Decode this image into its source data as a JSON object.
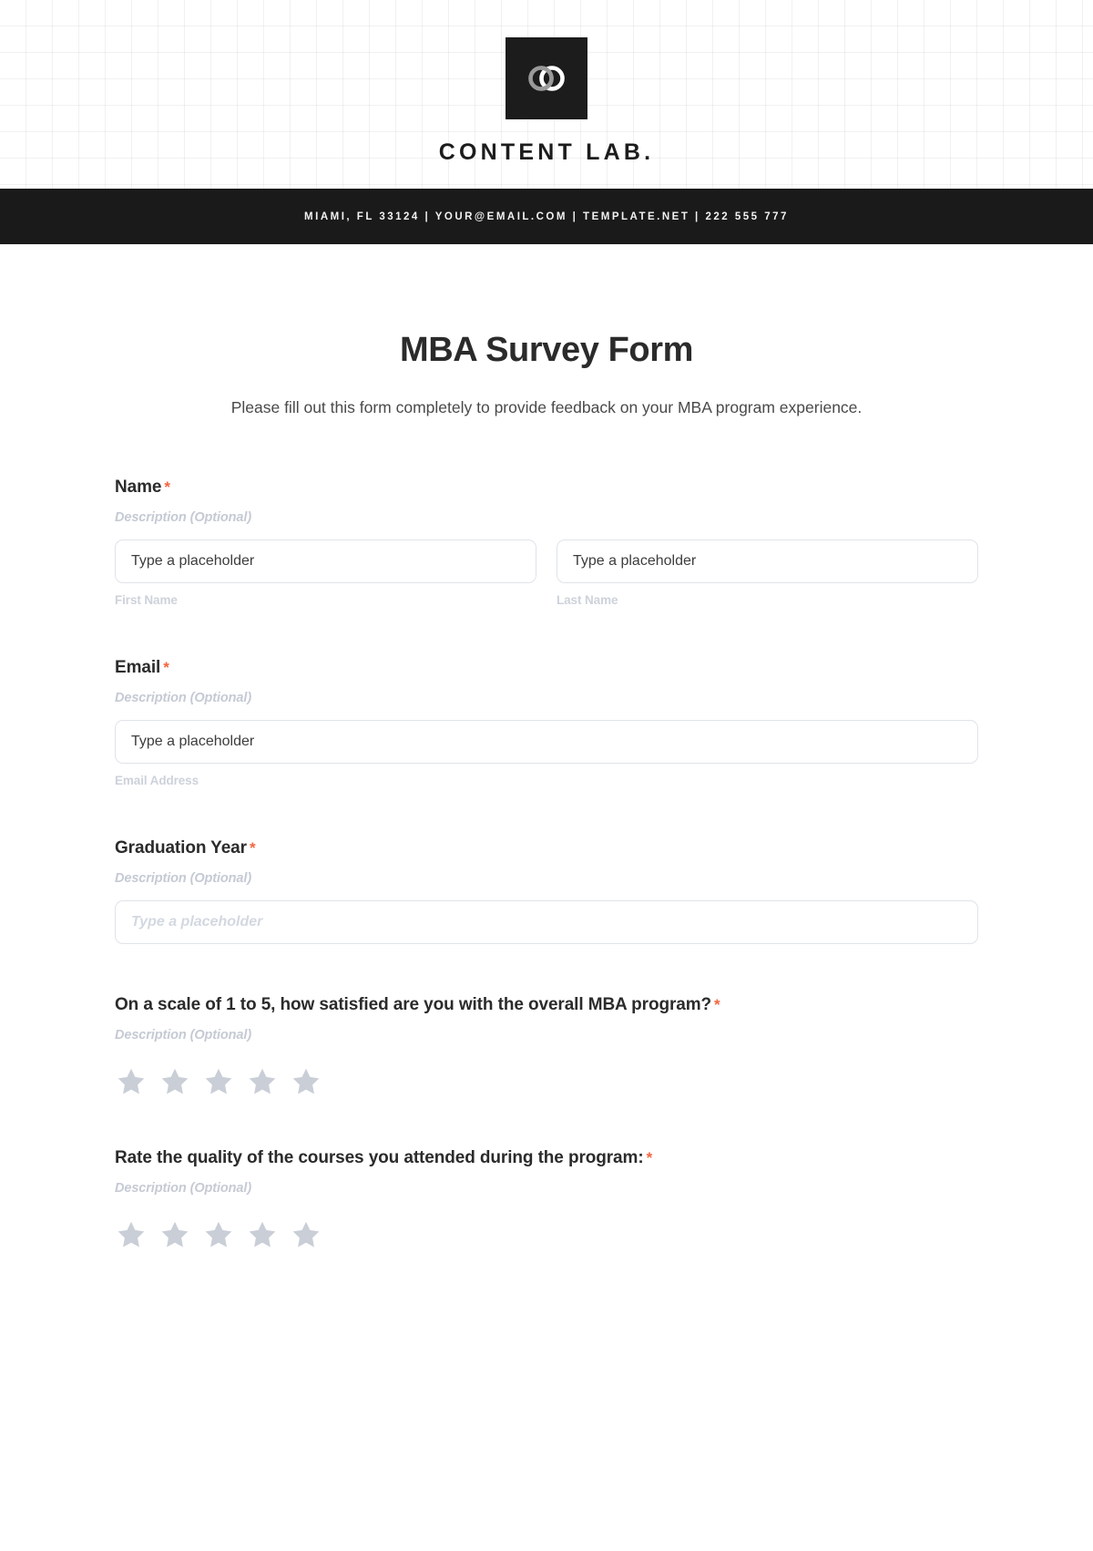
{
  "brand": {
    "logo_icon": "interlocking-rings-icon",
    "name": "CONTENT LAB.",
    "contact_line": "MIAMI, FL 33124 | YOUR@EMAIL.COM | TEMPLATE.NET | 222 555 777",
    "accent_dark": "#1a1a1a",
    "required_color": "#f4643f"
  },
  "form": {
    "title": "MBA Survey Form",
    "subtitle": "Please fill out this form completely to provide feedback on your MBA program experience.",
    "description_placeholder": "Description (Optional)",
    "required_mark": "*",
    "fields": [
      {
        "label": "Name",
        "description": "Description (Optional)",
        "inputs": [
          {
            "placeholder": "Type a placeholder",
            "value": "",
            "sub_label": "First Name"
          },
          {
            "placeholder": "Type a placeholder",
            "value": "",
            "sub_label": "Last Name"
          }
        ]
      },
      {
        "label": "Email",
        "description": "Description (Optional)",
        "inputs": [
          {
            "placeholder": "Type a placeholder",
            "value": "",
            "sub_label": "Email Address"
          }
        ]
      },
      {
        "label": "Graduation Year",
        "description": "Description (Optional)",
        "inputs": [
          {
            "placeholder": "Type a placeholder",
            "value": "",
            "sub_label": ""
          }
        ]
      },
      {
        "label": "On a scale of 1 to 5, how satisfied are you with the overall MBA program?",
        "description": "Description (Optional)",
        "rating": {
          "max": 5,
          "selected": 0,
          "icon": "star-icon",
          "color": "#c9ced7"
        }
      },
      {
        "label": "Rate the quality of the courses you attended during the program:",
        "description": "Description (Optional)",
        "rating": {
          "max": 5,
          "selected": 0,
          "icon": "star-icon",
          "color": "#c9ced7"
        }
      }
    ]
  }
}
